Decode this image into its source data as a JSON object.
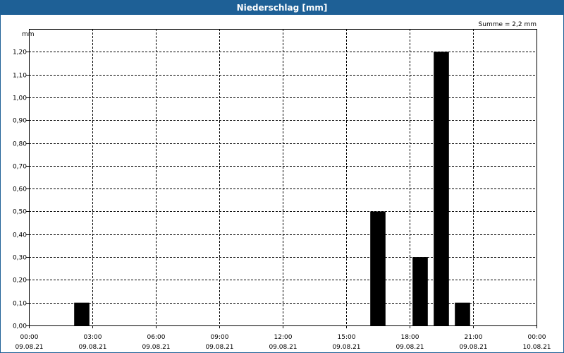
{
  "window": {
    "title": "Niederschlag [mm]"
  },
  "summary": "Summe = 2,2 mm",
  "colors": {
    "titlebar": "#1e6096",
    "bar": "#000000",
    "grid": "#000000"
  },
  "chart_data": {
    "type": "bar",
    "title": "Niederschlag [mm]",
    "ylabel": "mm",
    "ylim": [
      0,
      1.3
    ],
    "xlim": [
      "2021-08-09 00:00",
      "2021-08-10 00:00"
    ],
    "grid": true,
    "y_ticks": [
      "0,00",
      "0,10",
      "0,20",
      "0,30",
      "0,40",
      "0,50",
      "0,60",
      "0,70",
      "0,80",
      "0,90",
      "1,00",
      "1,10",
      "1,20"
    ],
    "x_ticks": [
      {
        "time": "00:00",
        "date": "09.08.21"
      },
      {
        "time": "03:00",
        "date": "09.08.21"
      },
      {
        "time": "06:00",
        "date": "09.08.21"
      },
      {
        "time": "09:00",
        "date": "09.08.21"
      },
      {
        "time": "12:00",
        "date": "09.08.21"
      },
      {
        "time": "15:00",
        "date": "09.08.21"
      },
      {
        "time": "18:00",
        "date": "09.08.21"
      },
      {
        "time": "21:00",
        "date": "09.08.21"
      },
      {
        "time": "00:00",
        "date": "10.08.21"
      }
    ],
    "bars": [
      {
        "start": "2021-08-09 02:00",
        "end": "2021-08-09 03:00",
        "value": 0.1
      },
      {
        "start": "2021-08-09 16:00",
        "end": "2021-08-09 17:00",
        "value": 0.5
      },
      {
        "start": "2021-08-09 18:00",
        "end": "2021-08-09 19:00",
        "value": 0.3
      },
      {
        "start": "2021-08-09 19:00",
        "end": "2021-08-09 20:00",
        "value": 1.2
      },
      {
        "start": "2021-08-09 20:00",
        "end": "2021-08-09 21:00",
        "value": 0.1
      }
    ]
  }
}
